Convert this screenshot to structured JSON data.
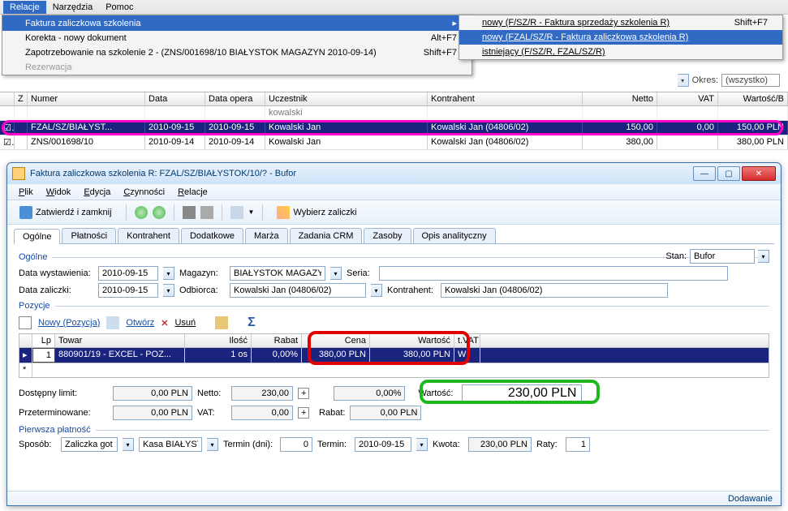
{
  "menubar": {
    "relacje": "Relacje",
    "narzedzia": "Narzędzia",
    "pomoc": "Pomoc"
  },
  "menu": {
    "items": [
      {
        "label": "Faktura zaliczkowa szkolenia",
        "shortcut": "",
        "arrow": true,
        "hl": true
      },
      {
        "label": "Korekta - nowy dokument",
        "shortcut": "Alt+F7"
      },
      {
        "label": "Zapotrzebowanie na szkolenie 2 - (ZNS/001698/10 BIAŁYSTOK MAGAZYN 2010-09-14)",
        "shortcut": "Shift+F7"
      },
      {
        "label": "Rezerwacja",
        "shortcut": "",
        "disabled": true
      }
    ]
  },
  "submenu": {
    "items": [
      {
        "label": "nowy (F/SZ/R - Faktura sprzedaży szkolenia R)",
        "shortcut": "Shift+F7"
      },
      {
        "label": "nowy (FZAL/SZ/R - Faktura zaliczkowa szkolenia R)",
        "hl": true
      },
      {
        "label": "istniejący (F/SZ/R, FZAL/SZ/R)"
      }
    ]
  },
  "bg": {
    "okres_label": "Okres:",
    "okres_val": "(wszystko)"
  },
  "grid": {
    "headers": {
      "z": "Z",
      "numer": "Numer",
      "data": "Data",
      "dataop": "Data opera",
      "ucz": "Uczestnik",
      "kont": "Kontrahent",
      "netto": "Netto",
      "vat": "VAT",
      "wart": "Wartość/B"
    },
    "filter": {
      "ucz": "kowalski"
    },
    "rows": [
      {
        "chk": "☑",
        "num": "FZAL/SZ/BIAŁYST...",
        "data": "2010-09-15",
        "op": "2010-09-15",
        "ucz": "Kowalski Jan",
        "kont": "Kowalski Jan (04806/02)",
        "net": "150,00",
        "vat": "0,00",
        "wart": "150,00 PLN",
        "sel": true
      },
      {
        "chk": "☑",
        "num": "ZNS/001698/10",
        "data": "2010-09-14",
        "op": "2010-09-14",
        "ucz": "Kowalski Jan",
        "kont": "Kowalski Jan (04806/02)",
        "net": "380,00",
        "vat": "",
        "wart": "380,00 PLN"
      }
    ]
  },
  "child": {
    "title": "Faktura zaliczkowa szkolenia R: FZAL/SZ/BIAŁYSTOK/10/? - Bufor",
    "menu": {
      "plik": "Plik",
      "widok": "Widok",
      "edycja": "Edycja",
      "czyn": "Czynności",
      "rel": "Relacje"
    },
    "toolbar": {
      "zatw": "Zatwierdź i zamknij",
      "wybierz": "Wybierz zaliczki"
    },
    "tabs": [
      "Ogólne",
      "Płatności",
      "Kontrahent",
      "Dodatkowe",
      "Marża",
      "Zadania CRM",
      "Zasoby",
      "Opis analityczny"
    ],
    "section": {
      "ogolne": "Ogólne",
      "pozycje": "Pozycje",
      "platnosc": "Pierwsza płatność"
    },
    "stan": {
      "label": "Stan:",
      "val": "Bufor"
    },
    "form": {
      "data_wyst": {
        "label": "Data wystawienia:",
        "val": "2010-09-15"
      },
      "magazyn": {
        "label": "Magazyn:",
        "val": "BIAŁYSTOK MAGAZY"
      },
      "seria": {
        "label": "Seria:",
        "val": ""
      },
      "data_zal": {
        "label": "Data zaliczki:",
        "val": "2010-09-15"
      },
      "odbiorca": {
        "label": "Odbiorca:",
        "val": "Kowalski Jan (04806/02)"
      },
      "kontrahent": {
        "label": "Kontrahent:",
        "val": "Kowalski Jan (04806/02)"
      }
    },
    "inner_tb": {
      "nowy": "Nowy (Pozycja)",
      "otworz": "Otwórz",
      "usun": "Usuń"
    },
    "inner_head": {
      "lp": "Lp",
      "towar": "Towar",
      "ilosc": "Ilość",
      "rabat": "Rabat",
      "cena": "Cena",
      "wart": "Wartość",
      "vat": "t.VAT"
    },
    "inner_row": {
      "lp": "1",
      "towar": "880901/19 - EXCEL - POZ...",
      "ilosc": "1 os",
      "rabat": "0,00%",
      "cena": "380,00 PLN",
      "wart": "380,00 PLN",
      "vat": "W"
    },
    "totals": {
      "limit": {
        "label": "Dostępny limit:",
        "val": "0,00 PLN"
      },
      "przet": {
        "label": "Przeterminowane:",
        "val": "0,00 PLN"
      },
      "netto": {
        "label": "Netto:",
        "val": "230,00"
      },
      "vat": {
        "label": "VAT:",
        "val": "0,00"
      },
      "rabat": {
        "label": "Rabat:",
        "pct": "0,00%",
        "amt": "0,00 PLN"
      },
      "wartosc": {
        "label": "Wartość:",
        "val": "230,00 PLN"
      }
    },
    "payment": {
      "sposob": {
        "label": "Sposób:",
        "val": "Zaliczka got"
      },
      "kasa": "Kasa BIAŁYST",
      "termin_dni": {
        "label": "Termin (dni):",
        "val": "0"
      },
      "termin": {
        "label": "Termin:",
        "val": "2010-09-15"
      },
      "kwota": {
        "label": "Kwota:",
        "val": "230,00 PLN"
      },
      "raty": {
        "label": "Raty:",
        "val": "1"
      }
    },
    "status": "Dodawanie"
  }
}
